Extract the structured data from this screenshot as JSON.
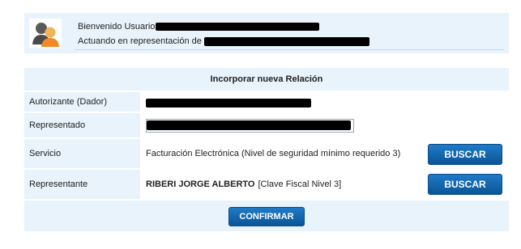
{
  "header": {
    "welcome_label": "Bienvenido Usuario",
    "acting_label": "Actuando en representación de"
  },
  "form": {
    "title": "Incorporar nueva Relación",
    "rows": [
      {
        "label": "Autorizante (Dador)"
      },
      {
        "label": "Representado"
      },
      {
        "label": "Servicio",
        "value": "Facturación Electrónica (Nivel de seguridad mínimo requerido 3)",
        "button": "BUSCAR"
      },
      {
        "label": "Representante",
        "name": "RIBERI JORGE ALBERTO",
        "detail": "[Clave Fiscal Nivel 3]",
        "button": "BUSCAR"
      }
    ],
    "confirm_label": "CONFIRMAR"
  },
  "icons": {
    "user": "users-icon"
  },
  "colors": {
    "panel": "#e8f3fb",
    "button": "#0a5596"
  }
}
